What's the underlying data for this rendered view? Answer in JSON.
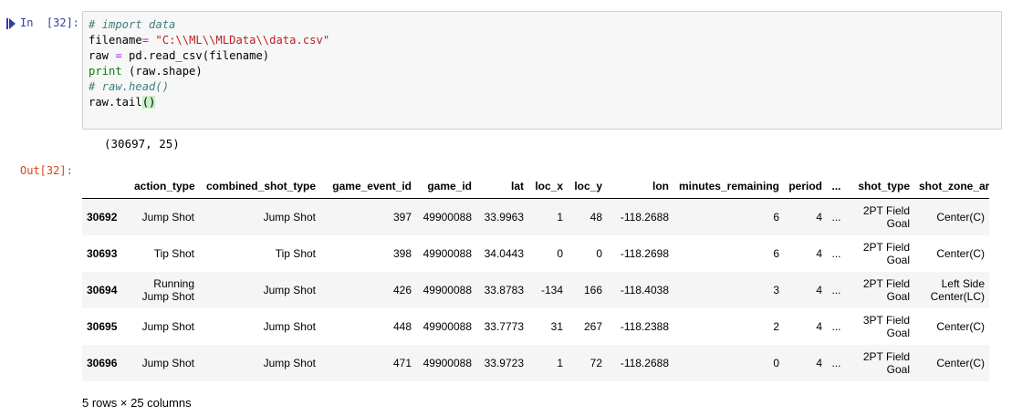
{
  "cell": {
    "in_label": "In",
    "in_count": "[32]:",
    "out_label": "Out[32]:",
    "code": {
      "line1_comment": "# import data",
      "line2_var": "filename",
      "line2_eq": "=",
      "line2_str": "\"C:\\\\ML\\\\MLData\\\\data.csv\"",
      "line3_var": "raw ",
      "line3_eq": "=",
      "line3_rest": " pd.read_csv(filename)",
      "line4_kw": "print",
      "line4_rest": " (raw.shape)",
      "line5_comment": "# raw.head()",
      "line6_code": "raw.tail",
      "line6_paren": "()"
    },
    "stdout": "(30697, 25)"
  },
  "table": {
    "columns": [
      "",
      "action_type",
      "combined_shot_type",
      "game_event_id",
      "game_id",
      "lat",
      "loc_x",
      "loc_y",
      "lon",
      "minutes_remaining",
      "period",
      "...",
      "shot_type",
      "shot_zone_area"
    ],
    "rows": [
      [
        "30692",
        "Jump Shot",
        "Jump Shot",
        "397",
        "49900088",
        "33.9963",
        "1",
        "48",
        "-118.2688",
        "6",
        "4",
        "...",
        "2PT Field Goal",
        "Center(C)"
      ],
      [
        "30693",
        "Tip Shot",
        "Tip Shot",
        "398",
        "49900088",
        "34.0443",
        "0",
        "0",
        "-118.2698",
        "6",
        "4",
        "...",
        "2PT Field Goal",
        "Center(C)"
      ],
      [
        "30694",
        "Running Jump Shot",
        "Jump Shot",
        "426",
        "49900088",
        "33.8783",
        "-134",
        "166",
        "-118.4038",
        "3",
        "4",
        "...",
        "2PT Field Goal",
        "Left Side Center(LC)"
      ],
      [
        "30695",
        "Jump Shot",
        "Jump Shot",
        "448",
        "49900088",
        "33.7773",
        "31",
        "267",
        "-118.2388",
        "2",
        "4",
        "...",
        "3PT Field Goal",
        "Center(C)"
      ],
      [
        "30696",
        "Jump Shot",
        "Jump Shot",
        "471",
        "49900088",
        "33.9723",
        "1",
        "72",
        "-118.2688",
        "0",
        "4",
        "...",
        "2PT Field Goal",
        "Center(C)"
      ]
    ],
    "footer": "5 rows × 25 columns"
  }
}
